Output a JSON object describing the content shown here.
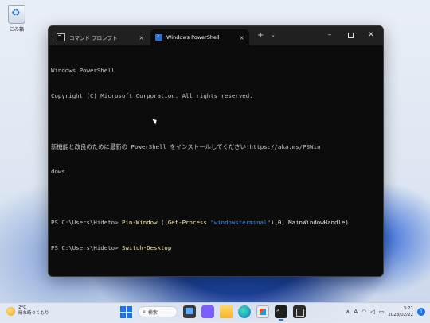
{
  "desktop": {
    "recycle_bin_label": "ごみ箱"
  },
  "window": {
    "tabs": [
      {
        "label": "コマンド プロンプト",
        "icon": "cmd-icon"
      },
      {
        "label": "Windows PowerShell",
        "icon": "powershell-icon"
      }
    ],
    "new_tab": "+",
    "dropdown": "⌄",
    "controls": {
      "minimize": "–",
      "close": "✕"
    }
  },
  "terminal": {
    "banner1": "Windows PowerShell",
    "banner2": "Copyright (C) Microsoft Corporation. All rights reserved.",
    "notice1": "新機能と改良のために最新の PowerShell をインストールしてください!https://aka.ms/PSWin",
    "notice2": "dows",
    "prompt": "PS C:\\Users\\Hideto> ",
    "cmd1_a": "Pin-Window",
    "cmd1_b": " ((",
    "cmd1_c": "Get-Process",
    "cmd1_d": " ",
    "cmd1_e": "\"windowsterminal\"",
    "cmd1_f": ")[0].MainWindowHandle)",
    "cmd2": "Switch-Desktop"
  },
  "taskbar": {
    "weather_temp": "2°C",
    "weather_desc": "晴れ時々くもり",
    "search_label": "検索",
    "tray_chevron": "∧",
    "lang": "A",
    "time": "3:21",
    "date": "2023/02/22",
    "notifications": "1"
  }
}
